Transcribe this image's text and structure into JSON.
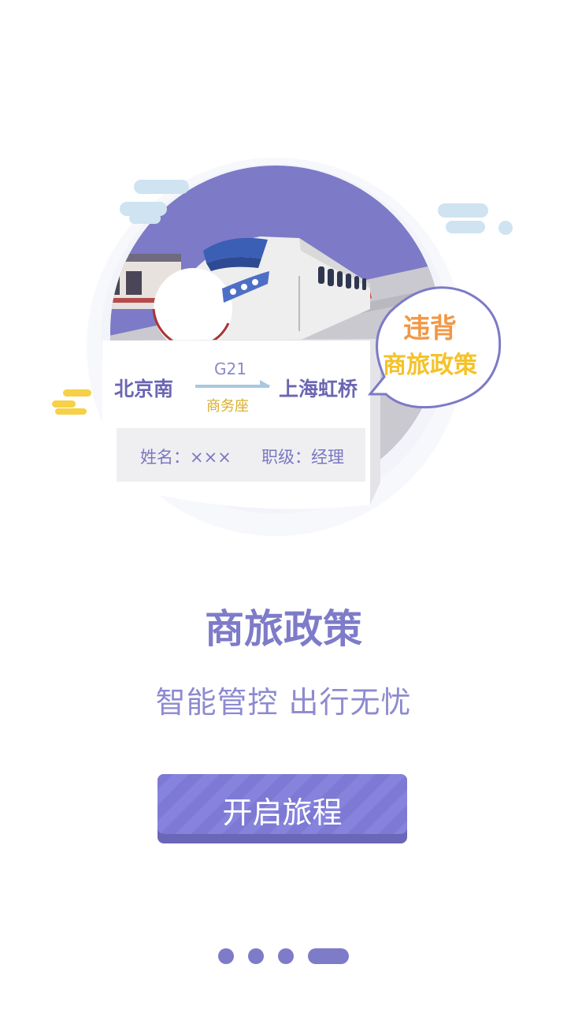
{
  "illustration": {
    "ticket": {
      "from": "北京南",
      "to": "上海虹桥",
      "train": "G21",
      "seat": "商务座",
      "passenger": "姓名：×××",
      "rank": "职级：经理"
    },
    "bubble": {
      "line1": "违背",
      "line2": "商旅政策"
    }
  },
  "headline": "商旅政策",
  "subline": "智能管控  出行无忧",
  "button": {
    "label": "开启旅程"
  },
  "pager": {
    "count": 4,
    "active_index": 4
  },
  "colors": {
    "primary": "#7e7bc8",
    "circle": "#7d7ac7",
    "bubble_orange": "#f29746",
    "bubble_yellow": "#f5c228",
    "cloud_blue": "#cfe3f1",
    "cloud_yellow": "#f6d046"
  }
}
